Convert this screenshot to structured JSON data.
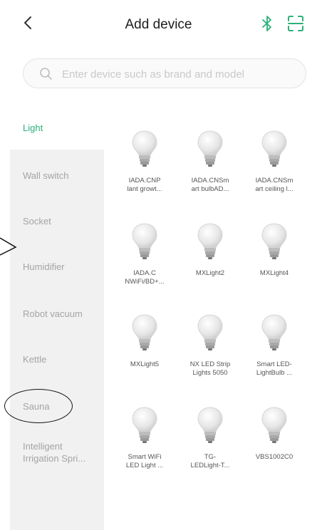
{
  "header": {
    "title": "Add device"
  },
  "search": {
    "placeholder": "Enter device such as brand and model"
  },
  "categories": {
    "selected": "Light",
    "items": [
      "Wall switch",
      "Socket",
      "Humidifier",
      "Robot vacuum",
      "Kettle",
      "Sauna",
      "Intelligent\nIrrigation Spri..."
    ]
  },
  "devices": [
    {
      "label": "IADA.CNP\nlant growt..."
    },
    {
      "label": "IADA.CNSm\nart bulbAD..."
    },
    {
      "label": "IADA.CNSm\nart ceiling l..."
    },
    {
      "label": "IADA.C\nNWiFi/BD+..."
    },
    {
      "label": "MXLight2"
    },
    {
      "label": "MXLight4"
    },
    {
      "label": "MXLight5"
    },
    {
      "label": "NX LED Strip\nLights 5050"
    },
    {
      "label": "Smart LED-\nLightBulb ..."
    },
    {
      "label": "Smart WiFi\nLED Light ..."
    },
    {
      "label": "TG-\nLEDLight-T..."
    },
    {
      "label": "VBS1002C0"
    }
  ],
  "colors": {
    "accent": "#2bb17a",
    "muted": "#a4a4a4",
    "sidebar_bg": "#f1f1f1"
  },
  "icons": [
    "back-chevron-icon",
    "bluetooth-icon",
    "scan-icon",
    "search-icon",
    "light-bulb-icon"
  ]
}
